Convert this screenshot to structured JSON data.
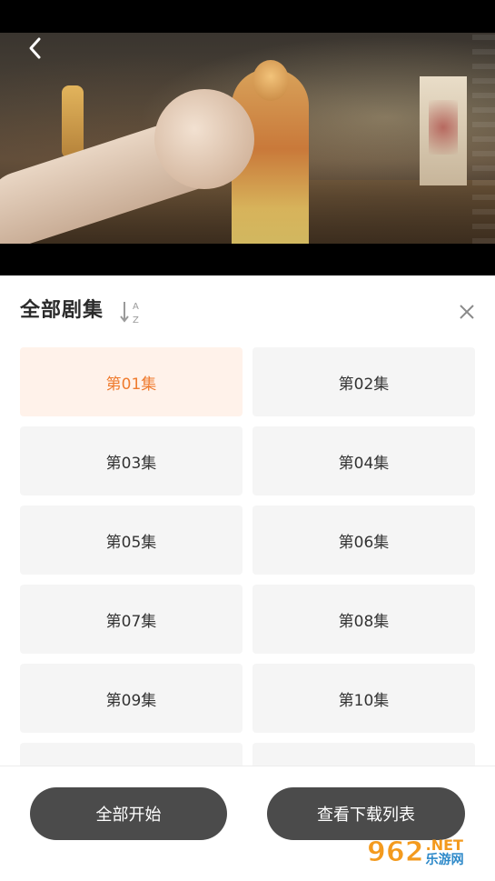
{
  "video": {
    "back_icon": "chevron-left-icon"
  },
  "panel": {
    "title": "全部剧集",
    "sort_icon": "sort-az-icon",
    "sort_letters": [
      "A",
      "Z"
    ],
    "close_icon": "close-icon"
  },
  "episodes": [
    {
      "label": "第01集",
      "selected": true
    },
    {
      "label": "第02集",
      "selected": false
    },
    {
      "label": "第03集",
      "selected": false
    },
    {
      "label": "第04集",
      "selected": false
    },
    {
      "label": "第05集",
      "selected": false
    },
    {
      "label": "第06集",
      "selected": false
    },
    {
      "label": "第07集",
      "selected": false
    },
    {
      "label": "第08集",
      "selected": false
    },
    {
      "label": "第09集",
      "selected": false
    },
    {
      "label": "第10集",
      "selected": false
    },
    {
      "label": "",
      "selected": false
    },
    {
      "label": "",
      "selected": false
    }
  ],
  "bottom": {
    "start_all_label": "全部开始",
    "download_list_label": "查看下载列表"
  },
  "watermark": {
    "number": "962",
    "domain": ".NET",
    "cn_text": "乐游网"
  },
  "colors": {
    "accent": "#ef7b2e",
    "selected_bg": "#fff2ea",
    "tile_bg": "#f5f5f5",
    "button_bg": "#4b4b4b"
  }
}
